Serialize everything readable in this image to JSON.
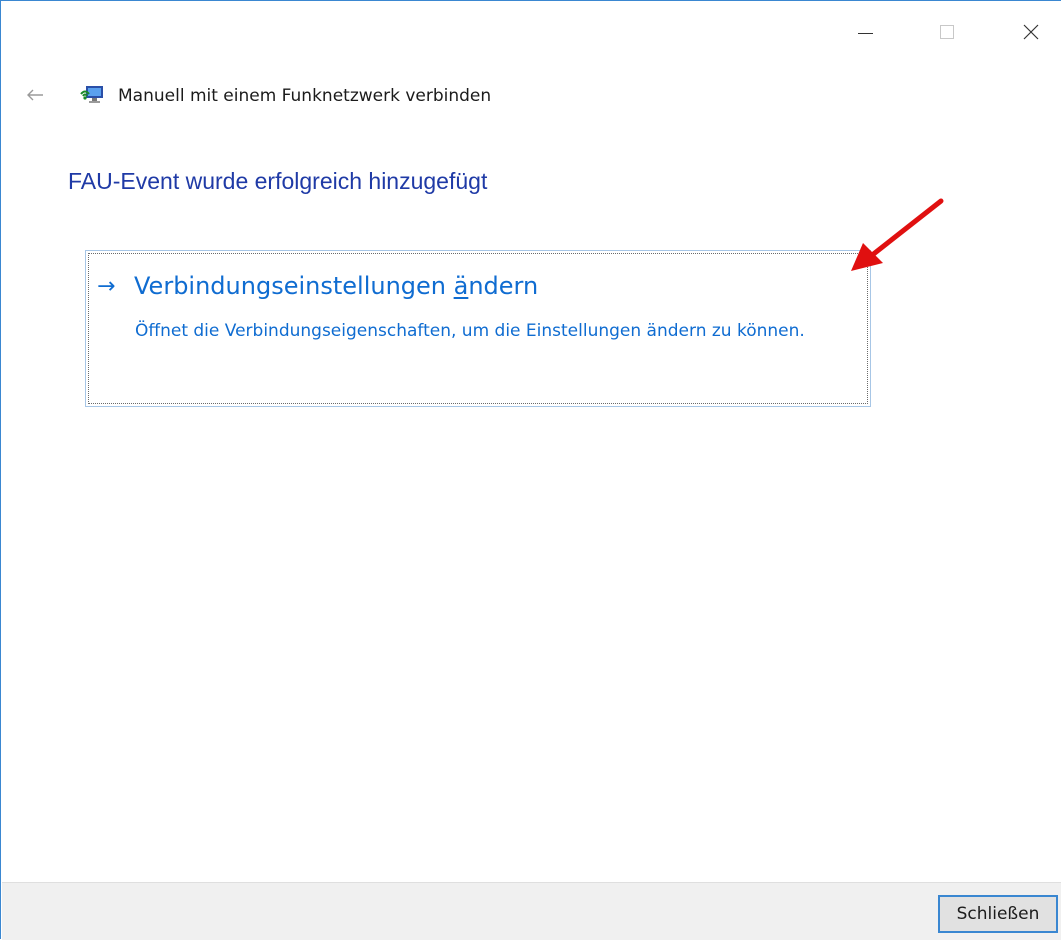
{
  "window": {
    "controls": {
      "minimize": "minimize-icon",
      "maximize": "maximize-icon",
      "close": "close-icon"
    }
  },
  "header": {
    "back_icon": "back-arrow-icon",
    "app_icon": "wireless-network-icon",
    "title": "Manuell mit einem Funknetzwerk verbinden"
  },
  "main": {
    "heading": "FAU-Event wurde erfolgreich hinzugefügt",
    "command_link": {
      "arrow": "→",
      "title_before": "Verbindungseinstellungen ",
      "title_access_key": "ä",
      "title_after": "ndern",
      "description": "Öffnet die Verbindungseigenschaften, um die Einstellungen ändern zu können."
    }
  },
  "annotation": {
    "icon": "red-pointer-arrow-icon",
    "color": "#e01010"
  },
  "footer": {
    "close_button_label": "Schließen"
  },
  "colors": {
    "heading": "#1f3aa6",
    "link": "#0f6cd1",
    "window_border": "#3a87d1",
    "footer_bg": "#f0f0f0"
  }
}
